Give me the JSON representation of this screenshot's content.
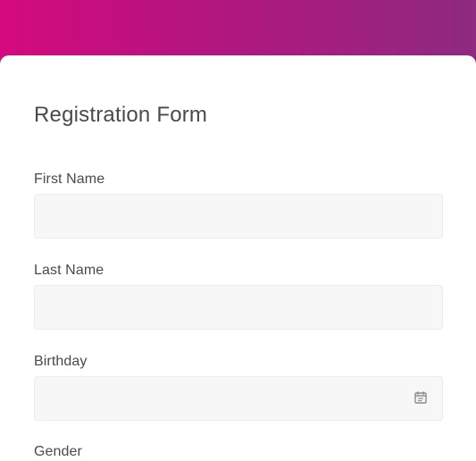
{
  "header": {
    "gradient_start": "#d40a7e",
    "gradient_end": "#8e2a80"
  },
  "form": {
    "title": "Registration Form",
    "first_name": {
      "label": "First Name",
      "value": ""
    },
    "last_name": {
      "label": "Last Name",
      "value": ""
    },
    "birthday": {
      "label": "Birthday",
      "value": "",
      "icon": "calendar-icon"
    },
    "gender": {
      "label": "Gender"
    }
  }
}
